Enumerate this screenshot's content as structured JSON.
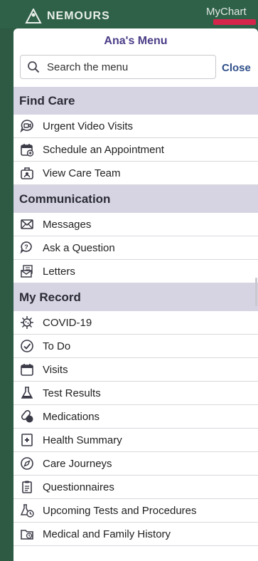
{
  "header": {
    "brand": "NEMOURS",
    "mychart": "MyChart"
  },
  "menu": {
    "title": "Ana's Menu",
    "search_placeholder": "Search the menu",
    "close_label": "Close",
    "sections": [
      {
        "title": "Find Care",
        "items": [
          {
            "label": "Urgent Video Visits",
            "icon": "video-chat-icon"
          },
          {
            "label": "Schedule an Appointment",
            "icon": "calendar-plus-icon"
          },
          {
            "label": "View Care Team",
            "icon": "care-team-icon"
          }
        ]
      },
      {
        "title": "Communication",
        "items": [
          {
            "label": "Messages",
            "icon": "envelope-icon"
          },
          {
            "label": "Ask a Question",
            "icon": "question-bubble-icon"
          },
          {
            "label": "Letters",
            "icon": "letters-icon"
          }
        ]
      },
      {
        "title": "My Record",
        "items": [
          {
            "label": "COVID-19",
            "icon": "virus-icon"
          },
          {
            "label": "To Do",
            "icon": "clock-check-icon"
          },
          {
            "label": "Visits",
            "icon": "calendar-icon"
          },
          {
            "label": "Test Results",
            "icon": "flask-icon"
          },
          {
            "label": "Medications",
            "icon": "pills-icon"
          },
          {
            "label": "Health Summary",
            "icon": "health-summary-icon"
          },
          {
            "label": "Care Journeys",
            "icon": "compass-icon"
          },
          {
            "label": "Questionnaires",
            "icon": "clipboard-icon"
          },
          {
            "label": "Upcoming Tests and Procedures",
            "icon": "flask-clock-icon"
          },
          {
            "label": "Medical and Family History",
            "icon": "folder-clock-icon"
          }
        ]
      }
    ]
  }
}
